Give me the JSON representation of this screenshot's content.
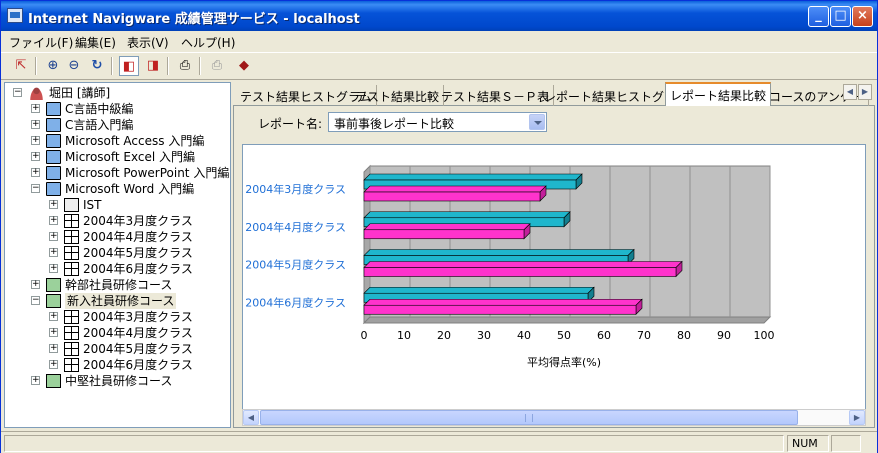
{
  "window": {
    "title": "Internet Navigware 成績管理サービス - localhost"
  },
  "menu": [
    {
      "label": "ファイル(F)"
    },
    {
      "label": "編集(E)"
    },
    {
      "label": "表示(V)"
    },
    {
      "label": "ヘルプ(H)"
    }
  ],
  "toolbar": {
    "icons": [
      "exit-icon",
      "zoom-in-icon",
      "zoom-out-icon",
      "refresh-icon",
      "view-left-icon",
      "view-right-icon",
      "print-preview-icon",
      "print-icon",
      "book-icon"
    ]
  },
  "tree": {
    "root": "堀田 [講師]",
    "nodes": [
      {
        "label": "C言語中級編",
        "level": 1,
        "icon": "monitor-icon",
        "expander": "+"
      },
      {
        "label": "C言語入門編",
        "level": 1,
        "icon": "monitor-icon",
        "expander": "+"
      },
      {
        "label": "Microsoft Access 入門編",
        "level": 1,
        "icon": "monitor-icon",
        "expander": "+"
      },
      {
        "label": "Microsoft Excel 入門編",
        "level": 1,
        "icon": "monitor-icon",
        "expander": "+"
      },
      {
        "label": "Microsoft PowerPoint 入門編",
        "level": 1,
        "icon": "monitor-icon",
        "expander": "+"
      },
      {
        "label": "Microsoft Word 入門編",
        "level": 1,
        "icon": "monitor-icon",
        "expander": "-"
      },
      {
        "label": "IST",
        "level": 2,
        "icon": "ist-icon",
        "expander": "+"
      },
      {
        "label": "2004年3月度クラス",
        "level": 2,
        "icon": "class-grid-icon",
        "expander": "+"
      },
      {
        "label": "2004年4月度クラス",
        "level": 2,
        "icon": "class-grid-icon",
        "expander": "+"
      },
      {
        "label": "2004年5月度クラス",
        "level": 2,
        "icon": "class-grid-icon",
        "expander": "+"
      },
      {
        "label": "2004年6月度クラス",
        "level": 2,
        "icon": "class-grid-icon",
        "expander": "+"
      },
      {
        "label": "幹部社員研修コース",
        "level": 1,
        "icon": "group-icon",
        "expander": "+"
      },
      {
        "label": "新入社員研修コース",
        "level": 1,
        "icon": "group-icon",
        "expander": "-",
        "selected": true
      },
      {
        "label": "2004年3月度クラス",
        "level": 2,
        "icon": "class-grid-icon",
        "expander": "+"
      },
      {
        "label": "2004年4月度クラス",
        "level": 2,
        "icon": "class-grid-icon",
        "expander": "+"
      },
      {
        "label": "2004年5月度クラス",
        "level": 2,
        "icon": "class-grid-icon",
        "expander": "+"
      },
      {
        "label": "2004年6月度クラス",
        "level": 2,
        "icon": "class-grid-icon",
        "expander": "+"
      },
      {
        "label": "中堅社員研修コース",
        "level": 1,
        "icon": "group-icon",
        "expander": "+"
      }
    ]
  },
  "tabs": [
    {
      "label": "テスト結果ヒストグラム"
    },
    {
      "label": "テスト結果比較"
    },
    {
      "label": "テスト結果Ｓ－Ｐ表"
    },
    {
      "label": "レポート結果ヒストグラム"
    },
    {
      "label": "レポート結果比較",
      "active": true
    },
    {
      "label": "コースのアンケー"
    }
  ],
  "report": {
    "label": "レポート名:",
    "selected": "事前事後レポート比較"
  },
  "status": {
    "num": "NUM"
  },
  "colors": {
    "series_a": "#1fb6cc",
    "series_b": "#ff33cc",
    "plot_bg": "#c0c0c0",
    "label_blue": "#1f6fd6"
  },
  "chart_data": {
    "type": "bar",
    "orientation": "horizontal",
    "style": "3d",
    "categories": [
      "2004年3月度クラス",
      "2004年4月度クラス",
      "2004年5月度クラス",
      "2004年6月度クラス"
    ],
    "series": [
      {
        "values": [
          53,
          50,
          66,
          56
        ]
      },
      {
        "values": [
          44,
          40,
          78,
          68
        ]
      }
    ],
    "xlabel": "平均得点率(%)",
    "xlim": [
      0,
      100
    ],
    "xticks": [
      "0",
      "10",
      "20",
      "30",
      "40",
      "50",
      "60",
      "70",
      "80",
      "90",
      "100"
    ],
    "grid": true
  }
}
